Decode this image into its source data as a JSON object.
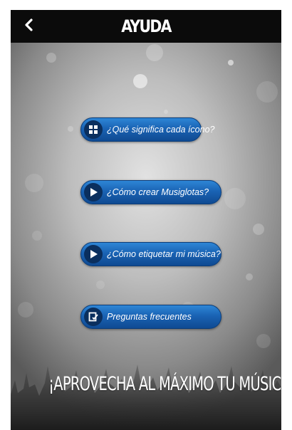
{
  "header": {
    "title": "AYUDA",
    "back_icon": "chevron-left-icon"
  },
  "menu": {
    "items": [
      {
        "label": "¿Qué significa cada ícono?",
        "icon": "grid-icon"
      },
      {
        "label": "¿Cómo crear Musiglotas?",
        "icon": "play-icon"
      },
      {
        "label": "¿Cómo etiquetar mi música?",
        "icon": "play-icon"
      },
      {
        "label": "Preguntas frecuentes",
        "icon": "edit-icon"
      }
    ]
  },
  "footer": {
    "slogan": "¡APROVECHA AL MÁXIMO TU MÚSICA!"
  },
  "colors": {
    "topbar": "#0b0b0b",
    "button": "#1a63b4",
    "button_dark": "#0f4a92"
  }
}
